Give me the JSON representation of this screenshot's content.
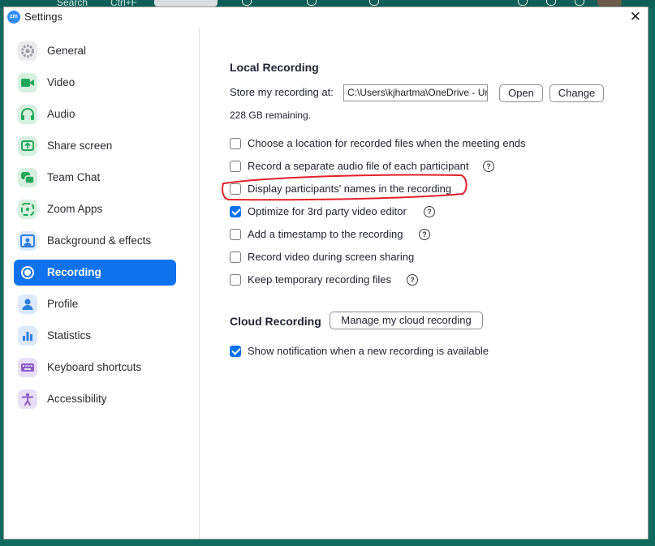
{
  "background": {
    "search_text": "Search",
    "shortcut_text": "Ctrl+F"
  },
  "window": {
    "title": "Settings",
    "app_icon_text": "zm",
    "close_glyph": "✕"
  },
  "sidebar": {
    "items": [
      {
        "label": "General",
        "icon": "gear-icon",
        "color": "#e6e6e8"
      },
      {
        "label": "Video",
        "icon": "video-camera-icon",
        "color": "#d3f0dd"
      },
      {
        "label": "Audio",
        "icon": "headphones-icon",
        "color": "#d3f0dd"
      },
      {
        "label": "Share screen",
        "icon": "share-screen-icon",
        "color": "#d3f0dd"
      },
      {
        "label": "Team Chat",
        "icon": "chat-icon",
        "color": "#d3f0dd"
      },
      {
        "label": "Zoom Apps",
        "icon": "apps-icon",
        "color": "#d3f0dd"
      },
      {
        "label": "Background & effects",
        "icon": "person-background-icon",
        "color": "#d8e8fb"
      },
      {
        "label": "Recording",
        "icon": "record-icon",
        "color": "#0e72ed",
        "active": true
      },
      {
        "label": "Profile",
        "icon": "profile-icon",
        "color": "#d8e8fb"
      },
      {
        "label": "Statistics",
        "icon": "statistics-icon",
        "color": "#d8e8fb"
      },
      {
        "label": "Keyboard shortcuts",
        "icon": "keyboard-icon",
        "color": "#e6dcf3"
      },
      {
        "label": "Accessibility",
        "icon": "accessibility-icon",
        "color": "#e6dcf3"
      }
    ]
  },
  "local_recording": {
    "heading": "Local Recording",
    "store_label": "Store my recording at:",
    "path_value": "C:\\Users\\kjhartma\\OneDrive - Ur",
    "open_button": "Open",
    "change_button": "Change",
    "remaining": "228 GB remaining.",
    "options": [
      {
        "label": "Choose a location for recorded files when the meeting ends",
        "checked": false,
        "help": false
      },
      {
        "label": "Record a separate audio file of each participant",
        "checked": false,
        "help": true
      },
      {
        "label": "Display participants' names in the recording",
        "checked": false,
        "help": false
      },
      {
        "label": "Optimize for 3rd party video editor",
        "checked": true,
        "help": true
      },
      {
        "label": "Add a timestamp to the recording",
        "checked": false,
        "help": true
      },
      {
        "label": "Record video during screen sharing",
        "checked": false,
        "help": false
      },
      {
        "label": "Keep temporary recording files",
        "checked": false,
        "help": true
      }
    ]
  },
  "cloud_recording": {
    "heading": "Cloud Recording",
    "manage_button": "Manage my cloud recording",
    "notification_label": "Show notification when a new recording is available",
    "notification_checked": true
  },
  "help_glyph": "?",
  "colors": {
    "accent": "#0e72ed",
    "annotation": "#e0202a"
  }
}
